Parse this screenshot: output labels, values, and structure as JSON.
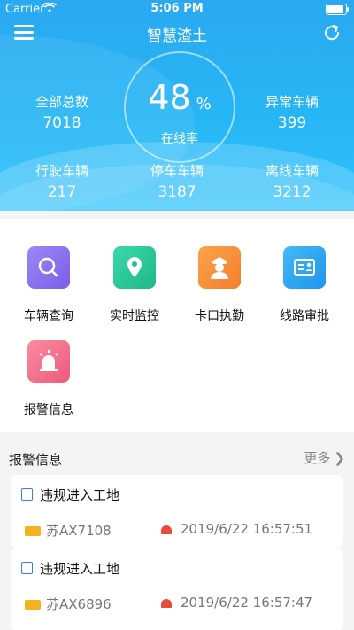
{
  "status_bar": {
    "carrier": "Carrier",
    "time": "5:06 PM"
  },
  "header": {
    "title": "智慧渣土",
    "online_rate": {
      "value": "48",
      "unit": "%",
      "label": "在线率"
    },
    "stats": [
      {
        "label": "全部总数",
        "value": "7018"
      },
      {
        "label": "异常车辆",
        "value": "399"
      },
      {
        "label": "行驶车辆",
        "value": "217"
      },
      {
        "label": "停车车辆",
        "value": "3187"
      },
      {
        "label": "离线车辆",
        "value": "3212"
      }
    ]
  },
  "functions": [
    {
      "label": "车辆查询",
      "icon": "search-icon",
      "color": "#8b6cf0"
    },
    {
      "label": "实时监控",
      "icon": "location-pin-icon",
      "color": "#28c89a"
    },
    {
      "label": "卡口执勤",
      "icon": "officer-icon",
      "color": "#f7933a"
    },
    {
      "label": "线路审批",
      "icon": "id-card-icon",
      "color": "#2fa9f2"
    },
    {
      "label": "报警信息",
      "icon": "siren-icon",
      "color": "#f26f8b"
    }
  ],
  "alerts": {
    "title": "报警信息",
    "more": "更多",
    "items": [
      {
        "type": "违规进入工地",
        "plate": "苏AX7108",
        "time": "2019/6/22 16:57:51"
      },
      {
        "type": "违规进入工地",
        "plate": "苏AX6896",
        "time": "2019/6/22 16:57:47"
      }
    ]
  }
}
